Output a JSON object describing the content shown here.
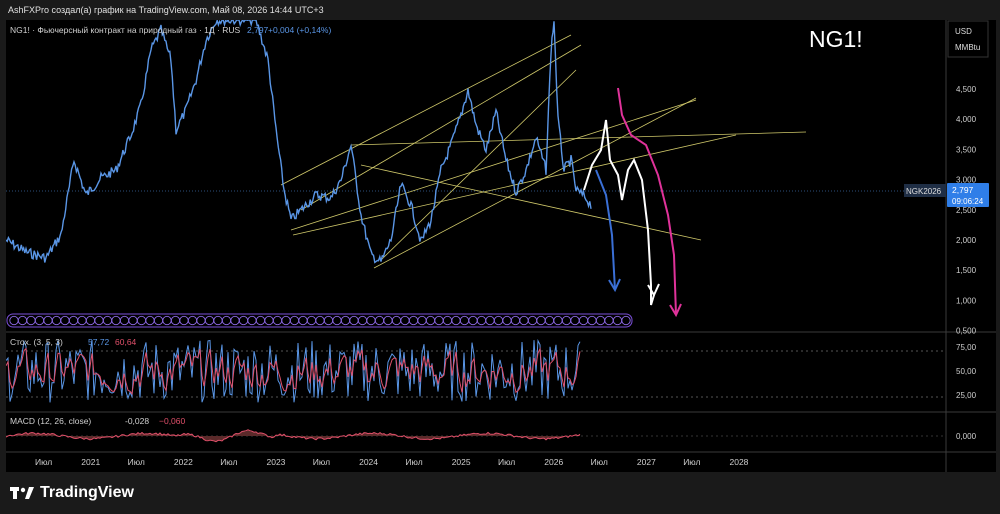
{
  "header": {
    "credit": "AshFXPro создал(а) график на TradingView.com, Май 08, 2026 14:44 UTC+3"
  },
  "legend": {
    "symbol": "NG1! · Фьючерсный контракт на природный газ · 1Д · RUS",
    "price": "2,797",
    "change": "+0,004 (+0,14%)"
  },
  "watermark": "NG1!",
  "axis": {
    "currency": "USD",
    "unit": "MMBtu",
    "price_ticks": [
      "4,500",
      "4,000",
      "3,500",
      "3,000",
      "2,500",
      "2,000",
      "1,500",
      "1,000",
      "0,500"
    ],
    "stoch_ticks": [
      "75,00",
      "50,00",
      "25,00"
    ],
    "macd_ticks": [
      "0,000"
    ],
    "time_ticks": [
      "Июл",
      "2021",
      "Июл",
      "2022",
      "Июл",
      "2023",
      "Июл",
      "2024",
      "Июл",
      "2025",
      "Июл",
      "2026",
      "Июл",
      "2027",
      "Июл",
      "2028"
    ]
  },
  "price_label": {
    "ticker": "NGK2026",
    "price": "2,797",
    "countdown": "09:06:24"
  },
  "stoch": {
    "label": "Стох. (3, 5, 3)",
    "k": "57,72",
    "d": "60,64"
  },
  "macd": {
    "label": "MACD (12, 26, close)",
    "v1": "-0,028",
    "v2": "−0,060"
  },
  "footer": {
    "brand": "TradingView"
  },
  "colors": {
    "price_line": "#5a96e6",
    "trendline": "#cfc86a",
    "projection_pink": "#e0329a",
    "projection_white": "#ffffff",
    "projection_blue": "#3a6fd6",
    "stoch_k": "#5a96e6",
    "stoch_d": "#e0506a",
    "background": "#000000"
  }
}
